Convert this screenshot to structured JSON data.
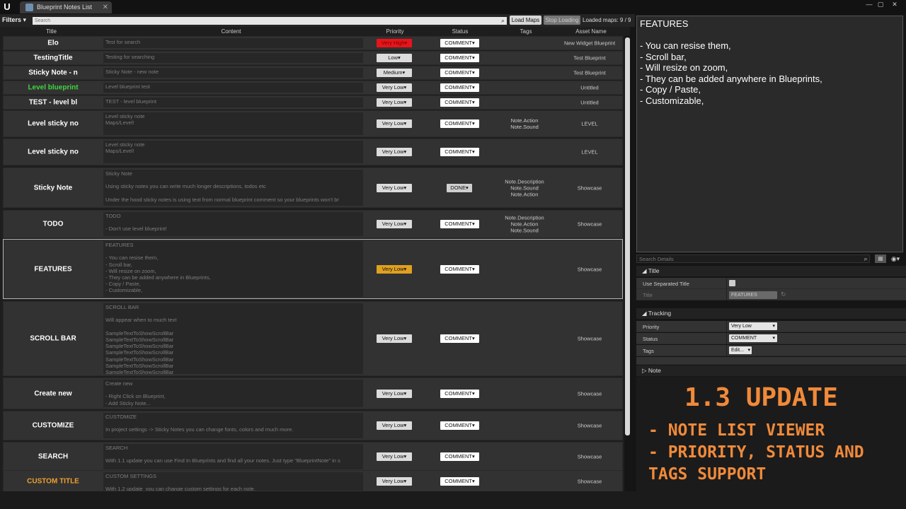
{
  "window": {
    "tab_title": "Blueprint Notes List",
    "min": "—",
    "max": "▢",
    "close": "✕"
  },
  "toolbar": {
    "filters": "Filters",
    "search_placeholder": "Search",
    "load_maps": "Load Maps",
    "stop_loading": "Stop Loading",
    "loaded_maps": "Loaded maps: 9 / 9"
  },
  "columns": {
    "title": "Title",
    "content": "Content",
    "priority": "Priority",
    "status": "Status",
    "tags": "Tags",
    "asset_name": "Asset Name"
  },
  "rows": [
    {
      "title": "Elo",
      "content": "Test for search",
      "priority": "Very High",
      "status": "COMMENT",
      "tags": "",
      "asset": "New Widget Blueprint"
    },
    {
      "title": "TestingTitle",
      "content": "Testing for searching",
      "priority": "Low",
      "status": "COMMENT",
      "tags": "",
      "asset": "Test Blueprint"
    },
    {
      "title": "Sticky Note - n",
      "content": "Sticky Note - new note",
      "priority": "Medium",
      "status": "COMMENT",
      "tags": "",
      "asset": "Test Blueprint"
    },
    {
      "title": "Level blueprint",
      "content": "Level blueprint test",
      "priority": "Very Low",
      "status": "COMMENT",
      "tags": "",
      "asset": "Untitled"
    },
    {
      "title": "TEST - level bl",
      "content": "TEST - level blueprint",
      "priority": "Very Low",
      "status": "COMMENT",
      "tags": "",
      "asset": "Untitled"
    },
    {
      "title": "Level sticky no",
      "content": "Level sticky note\nMaps/Level!",
      "priority": "Very Low",
      "status": "COMMENT",
      "tags": "Note.Action\nNote.Sound",
      "asset": "LEVEL"
    },
    {
      "title": "Level sticky no",
      "content": "Level sticky note\nMaps/Level!",
      "priority": "Very Low",
      "status": "COMMENT",
      "tags": "",
      "asset": "LEVEL"
    },
    {
      "title": "Sticky Note",
      "content": "Sticky Note\n\nUsing sticky notes you can write much longer descriptions, todos etc\n\nUnder the hood sticky notes is using text from normal blueprint comment so your blueprints won't br",
      "priority": "Very Low",
      "status": "DONE",
      "tags": "Note.Description\nNote.Sound\nNote.Action",
      "asset": "Showcase"
    },
    {
      "title": "TODO",
      "content": "TODO\n\n- Don't use level blueprint!",
      "priority": "Very Low",
      "status": "COMMENT",
      "tags": "Note.Description\nNote.Action\nNote.Sound",
      "asset": "Showcase"
    },
    {
      "title": "FEATURES",
      "content": "FEATURES\n\n- You can resise them,\n- Scroll bar,\n- Will resize on zoom,\n- They can be added anywhere in Blueprints,\n- Copy / Paste,\n- Customizable,",
      "priority": "Very Low",
      "status": "COMMENT",
      "tags": "",
      "asset": "Showcase"
    },
    {
      "title": "SCROLL BAR",
      "content": "SCROLL BAR\n\nWill appear when to much text\n\nSampleTextToShowScrollBar\nSampleTextToShowScrollBar\nSampleTextToShowScrollBar\nSampleTextToShowScrollBar\nSampleTextToShowScrollBar\nSampleTextToShowScrollBar\nSampleTextToShowScrollBar",
      "priority": "Very Low",
      "status": "COMMENT",
      "tags": "",
      "asset": "Showcase"
    },
    {
      "title": "Create new",
      "content": "Create new\n\n- Right Click on Blueprint,\n- Add Sticky Note...",
      "priority": "Very Low",
      "status": "COMMENT",
      "tags": "",
      "asset": "Showcase"
    },
    {
      "title": "CUSTOMIZE",
      "content": "CUSTOMIZE\n\nIn project settings -> Sticky Notes you can change fonts, colors and much more.",
      "priority": "Very Low",
      "status": "COMMENT",
      "tags": "",
      "asset": "Showcase"
    },
    {
      "title": "SEARCH",
      "content": "SEARCH\n\nWith 1.1 update you can use Find In Blueprints and find all your notes. Just type \"BlueprintNote\" in s",
      "priority": "Very Low",
      "status": "COMMENT",
      "tags": "",
      "asset": "Showcase"
    },
    {
      "title": "CUSTOM TITLE",
      "content": "CUSTOM SETTINGS\n\nWith 1.2 update  you can change custom settings for each note.",
      "priority": "Very Low",
      "status": "COMMENT",
      "tags": "",
      "asset": "Showcase"
    }
  ],
  "preview": {
    "text": "FEATURES\n\n- You can resise them,\n- Scroll bar,\n- Will resize on zoom,\n- They can be added anywhere in Blueprints,\n- Copy / Paste,\n- Customizable,"
  },
  "details": {
    "search_placeholder": "Search Details",
    "sections": {
      "title": "Title",
      "tracking": "Tracking",
      "note": "Note"
    },
    "use_separated_title": "Use Separated Title",
    "title_label": "Title",
    "title_value": "FEATURES",
    "priority_label": "Priority",
    "priority_value": "Very Low",
    "status_label": "Status",
    "status_value": "COMMENT",
    "tags_label": "Tags",
    "tags_value": "Edit..."
  },
  "update": {
    "title": "1.3 UPDATE",
    "line1": "- NOTE LIST VIEWER",
    "line2": "- PRIORITY, STATUS AND",
    "line3": "TAGS SUPPORT"
  },
  "colors": {
    "very_high": "#e8141a",
    "selected_priority": "#e0a020",
    "green_title": "#3fd63f",
    "orange_title": "#f0a030",
    "accent": "#f08a3a"
  },
  "icons": {
    "logo": "unreal-logo-icon",
    "search": "search-icon",
    "dropdown": "chevron-down-icon"
  }
}
